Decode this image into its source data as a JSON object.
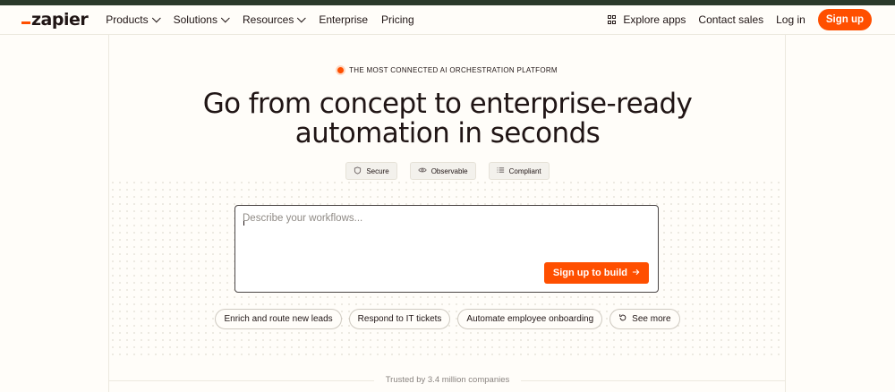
{
  "brand": {
    "logo_text": "zapier",
    "accent": "#ff4f00"
  },
  "nav": {
    "left": [
      {
        "label": "Products",
        "dropdown": true
      },
      {
        "label": "Solutions",
        "dropdown": true
      },
      {
        "label": "Resources",
        "dropdown": true
      },
      {
        "label": "Enterprise",
        "dropdown": false
      },
      {
        "label": "Pricing",
        "dropdown": false
      }
    ],
    "explore_apps": "Explore apps",
    "contact_sales": "Contact sales",
    "login": "Log in",
    "signup": "Sign up"
  },
  "hero": {
    "tagline": "THE MOST CONNECTED AI ORCHESTRATION PLATFORM",
    "headline_line1": "Go from concept to enterprise-ready",
    "headline_line2": "automation in seconds",
    "features": [
      {
        "label": "Secure",
        "icon": "shield-icon"
      },
      {
        "label": "Observable",
        "icon": "eye-icon"
      },
      {
        "label": "Compliant",
        "icon": "list-icon"
      }
    ]
  },
  "prompt": {
    "placeholder": "Describe your workflows...",
    "value": "",
    "button_label": "Sign up to build"
  },
  "suggestions": [
    "Enrich and route new leads",
    "Respond to IT tickets",
    "Automate employee onboarding"
  ],
  "see_more": "See more",
  "trusted": "Trusted by 3.4 million companies"
}
